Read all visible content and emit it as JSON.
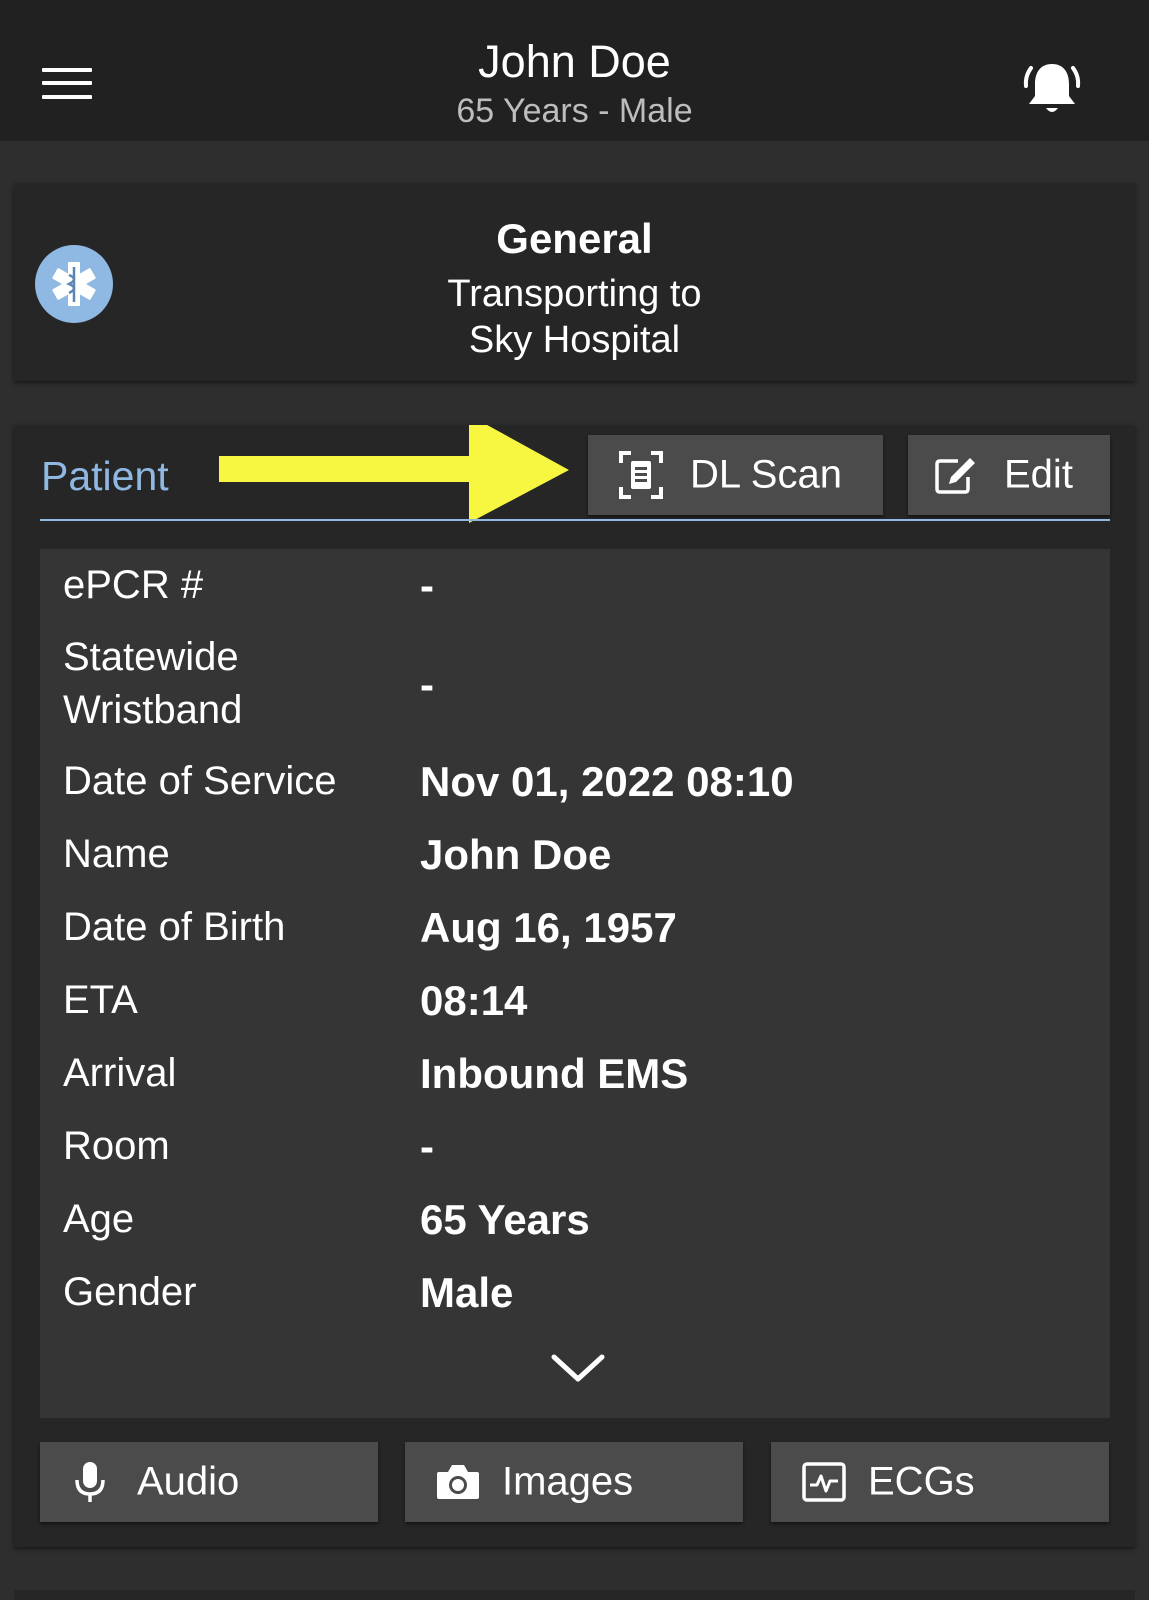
{
  "header": {
    "title": "John Doe",
    "subtitle": "65 Years - Male",
    "menu_icon": "hamburger-menu-icon",
    "alert_icon": "ringing-bell-icon"
  },
  "general": {
    "title": "General",
    "line1": "Transporting to",
    "line2": "Sky Hospital",
    "icon": "star-of-life-icon"
  },
  "patient": {
    "section_title": "Patient",
    "dl_scan_label": "DL Scan",
    "edit_label": "Edit",
    "rows": [
      {
        "label": "ePCR #",
        "value": "-"
      },
      {
        "label": "Statewide",
        "label2": "Wristband",
        "value": "-"
      },
      {
        "label": "Date of Service",
        "value": "Nov 01, 2022 08:10"
      },
      {
        "label": "Name",
        "value": "John Doe"
      },
      {
        "label": "Date of Birth",
        "value": "Aug 16, 1957"
      },
      {
        "label": "ETA",
        "value": "08:14"
      },
      {
        "label": "Arrival",
        "value": "Inbound EMS"
      },
      {
        "label": "Room",
        "value": "-"
      },
      {
        "label": "Age",
        "value": "65 Years"
      },
      {
        "label": "Gender",
        "value": "Male"
      }
    ]
  },
  "media": {
    "audio_label": "Audio",
    "images_label": "Images",
    "ecgs_label": "ECGs"
  },
  "colors": {
    "accent": "#8fb8e2",
    "annotation_arrow": "#f7f741",
    "header_bg": "#212121",
    "card_bg": "#262626",
    "panel_bg": "#353535",
    "button_bg": "#4b4b4b"
  }
}
